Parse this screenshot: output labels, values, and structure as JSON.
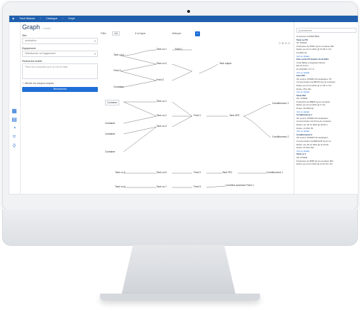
{
  "app": {
    "topbar": [
      "Track Balance",
      "Catalogue",
      "Graph"
    ],
    "title": "Graph",
    "subtitle": "Laster"
  },
  "filters": {
    "site_label": "Site",
    "site_value": "production",
    "equipment_label": "Equipement",
    "equipment_placeholder": "Sélectionner un Equipement",
    "search_label": "Recherche textile",
    "search_placeholder": "Filtrez les connections par un mot de base",
    "checkbox_label": "Afficher les marques simples",
    "button_label": "Rechercher"
  },
  "graph": {
    "toolbar": [
      "Filtre",
      "Uni",
      "6 en ligne",
      "Nettoyer"
    ],
    "nodes": [
      "Tank ou 1",
      "Tank ou 2",
      "Tank ou 3",
      "Feed 1",
      "Feed 2",
      "Feed 3",
      "Tank output",
      "Container",
      "Container",
      "Container",
      "Container",
      "Container",
      "Tank ou 1",
      "Tank ou 2",
      "Tank ou 3",
      "Tank ou 4",
      "Tank ou 5",
      "Tank ou 6",
      "Tank ou 7",
      "Tank ou 8",
      "Tank ou 9",
      "Feed 1",
      "Feed 2",
      "Feed 3",
      "Feed 4",
      "Tank UFE",
      "Tank FE2",
      "Conditionneur 1",
      "Conditionneur 2",
      "Combiné accessoir Feed 1",
      "Tank UH",
      "Conditionneur 1",
      "Container",
      "Tank ou 1",
      "Feed 2",
      "Conditioneur",
      "Toutes les connexions",
      "Container 1"
    ]
  },
  "right_panel": {
    "search_value": "processeurs",
    "lines": [
      "Connexion 12345678901",
      "Tank ou PO",
      "ST: 876400",
      "Production de BTEF Kg du container BIC",
      "Début: jeu 10 12 2021 @ 15:48 h / Fin",
      "15 2051 Kh",
      "Voir en détails",
      "Flux sortie PS fenêtre 10 12 2021",
      "Code    Balise enregistrée    Retour",
      "EH       21.0               21.0",
      "Ps ACK325    7.6              7.6",
      "Voir en détails",
      "Flux PTF",
      "OF source: 876406  OF destination: 87",
      "Consommation de BRIOG Kg du container",
      "Début: jeu 10 12 2021 @ 17:45 h / Fin",
      "Durée: 25m 45s",
      "Voir en détails",
      "Tank UFE",
      "OF: 876400",
      "Production de BBPZ Kg du container",
      "Début: jeu 10 12 2021 @ 17:24",
      "Durée: 39 4554 Kh",
      "Voir en détails",
      "Conditionneur 1",
      "OF source: 876406  OF destination",
      "Consommation de 54 Kg du container",
      "Début: ven 20 12 2021 @ 20:30 h",
      "Durée: 1h 45m 53",
      "Voir en détails",
      "Conditionneur 2",
      "OF source: 876406  OF destination",
      "Consommation de BEFHCR Kg du co",
      "Début: ven 20 12 2021 @ 11:24 Kh",
      "Durée: 2h 45m 53s",
      "Voir en détails",
      "Tank ou 4",
      "OF: 876400",
      "Production de 8565 Kg du container BIC",
      "Début: jeu 10 12 2021 @ 11:51 Kh / Fin"
    ]
  }
}
